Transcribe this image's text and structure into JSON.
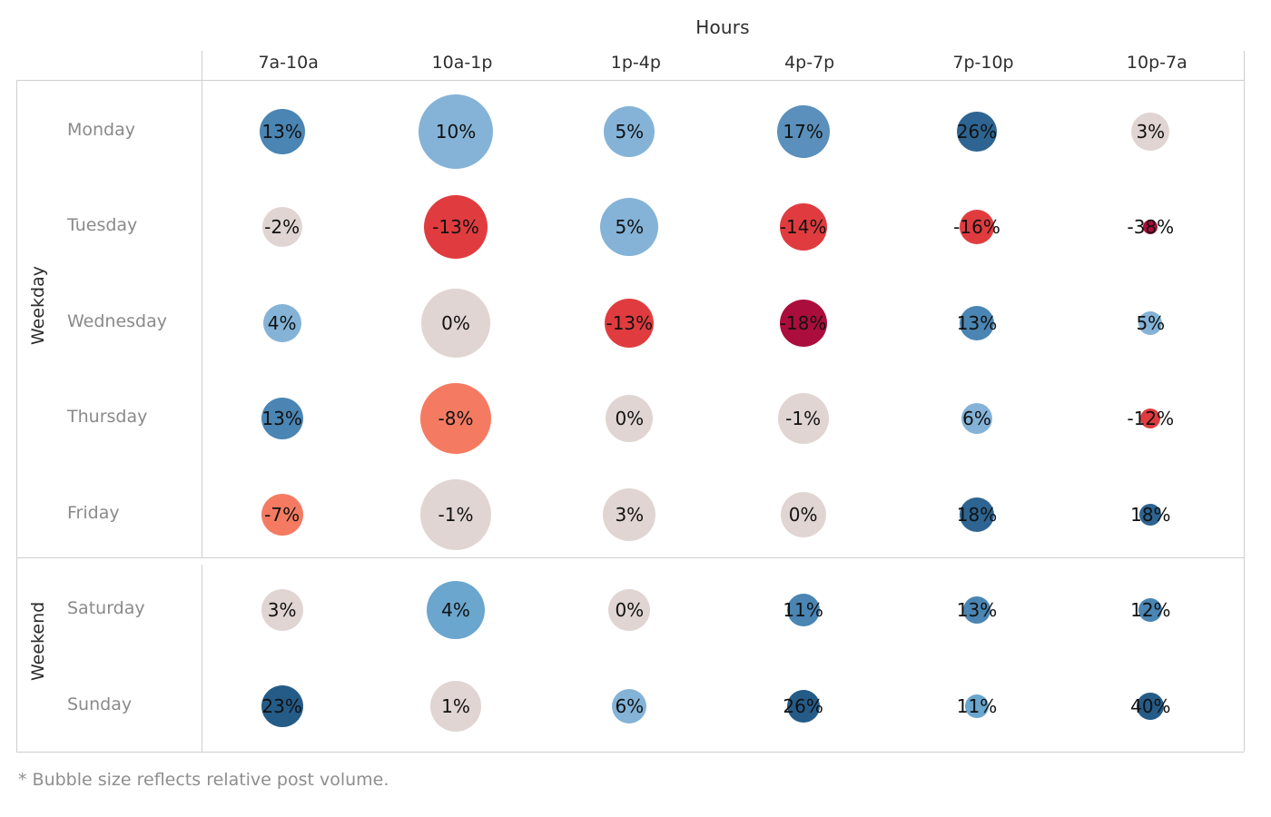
{
  "header": {
    "hours_title": "Hours"
  },
  "footnote": "* Bubble size reflects relative post volume.",
  "group_labels": {
    "weekday": "Weekday",
    "weekend": "Weekend"
  },
  "colors": {
    "grid": "#cfcfcf",
    "neutral": "#e0d5d2",
    "blue_light": "#84b3d7",
    "blue_mid": "#4a85b3",
    "blue_dark": "#255b87",
    "red_light": "#f47b62",
    "red_mid": "#e03c3f",
    "red_dark": "#ab0e3c",
    "label_text": "#111111",
    "row_label_text": "#8a8a8a",
    "header_text": "#2e2e2e",
    "footnote_text": "#8e8e8e"
  },
  "chart_data": {
    "type": "heatmap",
    "title": "Hours",
    "xlabel": "Hours",
    "ylabel": "",
    "note": "* Bubble size reflects relative post volume.",
    "categories": [
      "7a-10a",
      "10a-1p",
      "1p-4p",
      "4p-7p",
      "7p-10p",
      "10p-7a"
    ],
    "row_groups": [
      {
        "name": "Weekday",
        "rows": [
          "Monday",
          "Tuesday",
          "Wednesday",
          "Thursday",
          "Friday"
        ]
      },
      {
        "name": "Weekend",
        "rows": [
          "Saturday",
          "Sunday"
        ]
      }
    ],
    "rows": [
      "Monday",
      "Tuesday",
      "Wednesday",
      "Thursday",
      "Friday",
      "Saturday",
      "Sunday"
    ],
    "cells": [
      {
        "row": "Monday",
        "col": "7a-10a",
        "label": "13%",
        "value": 13,
        "size": 50,
        "color": "#4a85b3"
      },
      {
        "row": "Monday",
        "col": "10a-1p",
        "label": "10%",
        "value": 10,
        "size": 82,
        "color": "#84b3d7"
      },
      {
        "row": "Monday",
        "col": "1p-4p",
        "label": "5%",
        "value": 5,
        "size": 56,
        "color": "#84b3d7"
      },
      {
        "row": "Monday",
        "col": "4p-7p",
        "label": "17%",
        "value": 17,
        "size": 58,
        "color": "#5a90bb"
      },
      {
        "row": "Monday",
        "col": "7p-10p",
        "label": "26%",
        "value": 26,
        "size": 44,
        "color": "#2d6491"
      },
      {
        "row": "Monday",
        "col": "10p-7a",
        "label": "3%",
        "value": 3,
        "size": 42,
        "color": "#e0d5d2"
      },
      {
        "row": "Tuesday",
        "col": "7a-10a",
        "label": "-2%",
        "value": -2,
        "size": 44,
        "color": "#e0d5d2"
      },
      {
        "row": "Tuesday",
        "col": "10a-1p",
        "label": "-13%",
        "value": -13,
        "size": 70,
        "color": "#e03c3f"
      },
      {
        "row": "Tuesday",
        "col": "1p-4p",
        "label": "5%",
        "value": 5,
        "size": 64,
        "color": "#84b3d7"
      },
      {
        "row": "Tuesday",
        "col": "4p-7p",
        "label": "-14%",
        "value": -14,
        "size": 52,
        "color": "#e03c3f"
      },
      {
        "row": "Tuesday",
        "col": "7p-10p",
        "label": "-16%",
        "value": -16,
        "size": 38,
        "color": "#e03c3f"
      },
      {
        "row": "Tuesday",
        "col": "10p-7a",
        "label": "-38%",
        "value": -38,
        "size": 16,
        "color": "#ab0e3c"
      },
      {
        "row": "Wednesday",
        "col": "7a-10a",
        "label": "4%",
        "value": 4,
        "size": 42,
        "color": "#84b3d7"
      },
      {
        "row": "Wednesday",
        "col": "10a-1p",
        "label": "0%",
        "value": 0,
        "size": 76,
        "color": "#e0d5d2"
      },
      {
        "row": "Wednesday",
        "col": "1p-4p",
        "label": "-13%",
        "value": -13,
        "size": 54,
        "color": "#e03c3f"
      },
      {
        "row": "Wednesday",
        "col": "4p-7p",
        "label": "-18%",
        "value": -18,
        "size": 52,
        "color": "#ab0e3c"
      },
      {
        "row": "Wednesday",
        "col": "7p-10p",
        "label": "13%",
        "value": 13,
        "size": 38,
        "color": "#4a85b3"
      },
      {
        "row": "Wednesday",
        "col": "10p-7a",
        "label": "5%",
        "value": 5,
        "size": 26,
        "color": "#84b3d7"
      },
      {
        "row": "Thursday",
        "col": "7a-10a",
        "label": "13%",
        "value": 13,
        "size": 46,
        "color": "#4a85b3"
      },
      {
        "row": "Thursday",
        "col": "10a-1p",
        "label": "-8%",
        "value": -8,
        "size": 78,
        "color": "#f47b62"
      },
      {
        "row": "Thursday",
        "col": "1p-4p",
        "label": "0%",
        "value": 0,
        "size": 52,
        "color": "#e0d5d2"
      },
      {
        "row": "Thursday",
        "col": "4p-7p",
        "label": "-1%",
        "value": -1,
        "size": 56,
        "color": "#e0d5d2"
      },
      {
        "row": "Thursday",
        "col": "7p-10p",
        "label": "6%",
        "value": 6,
        "size": 34,
        "color": "#84b3d7"
      },
      {
        "row": "Thursday",
        "col": "10p-7a",
        "label": "-12%",
        "value": -12,
        "size": 22,
        "color": "#e03c3f"
      },
      {
        "row": "Friday",
        "col": "7a-10a",
        "label": "-7%",
        "value": -7,
        "size": 46,
        "color": "#f47b62"
      },
      {
        "row": "Friday",
        "col": "10a-1p",
        "label": "-1%",
        "value": -1,
        "size": 78,
        "color": "#e0d5d2"
      },
      {
        "row": "Friday",
        "col": "1p-4p",
        "label": "3%",
        "value": 3,
        "size": 58,
        "color": "#e0d5d2"
      },
      {
        "row": "Friday",
        "col": "4p-7p",
        "label": "0%",
        "value": 0,
        "size": 50,
        "color": "#e0d5d2"
      },
      {
        "row": "Friday",
        "col": "7p-10p",
        "label": "18%",
        "value": 18,
        "size": 38,
        "color": "#2d6491"
      },
      {
        "row": "Friday",
        "col": "10p-7a",
        "label": "18%",
        "value": 18,
        "size": 24,
        "color": "#2d6491"
      },
      {
        "row": "Saturday",
        "col": "7a-10a",
        "label": "3%",
        "value": 3,
        "size": 46,
        "color": "#e0d5d2"
      },
      {
        "row": "Saturday",
        "col": "10a-1p",
        "label": "4%",
        "value": 4,
        "size": 64,
        "color": "#6aa6ce"
      },
      {
        "row": "Saturday",
        "col": "1p-4p",
        "label": "0%",
        "value": 0,
        "size": 46,
        "color": "#e0d5d2"
      },
      {
        "row": "Saturday",
        "col": "4p-7p",
        "label": "11%",
        "value": 11,
        "size": 36,
        "color": "#4a85b3"
      },
      {
        "row": "Saturday",
        "col": "7p-10p",
        "label": "13%",
        "value": 13,
        "size": 30,
        "color": "#4a85b3"
      },
      {
        "row": "Saturday",
        "col": "10p-7a",
        "label": "12%",
        "value": 12,
        "size": 26,
        "color": "#4a85b3"
      },
      {
        "row": "Sunday",
        "col": "7a-10a",
        "label": "23%",
        "value": 23,
        "size": 46,
        "color": "#255b87"
      },
      {
        "row": "Sunday",
        "col": "10a-1p",
        "label": "1%",
        "value": 1,
        "size": 56,
        "color": "#e0d5d2"
      },
      {
        "row": "Sunday",
        "col": "1p-4p",
        "label": "6%",
        "value": 6,
        "size": 38,
        "color": "#84b3d7"
      },
      {
        "row": "Sunday",
        "col": "4p-7p",
        "label": "26%",
        "value": 26,
        "size": 36,
        "color": "#255b87"
      },
      {
        "row": "Sunday",
        "col": "7p-10p",
        "label": "11%",
        "value": 11,
        "size": 26,
        "color": "#6aa6ce"
      },
      {
        "row": "Sunday",
        "col": "10p-7a",
        "label": "40%",
        "value": 40,
        "size": 30,
        "color": "#255b87"
      }
    ]
  }
}
